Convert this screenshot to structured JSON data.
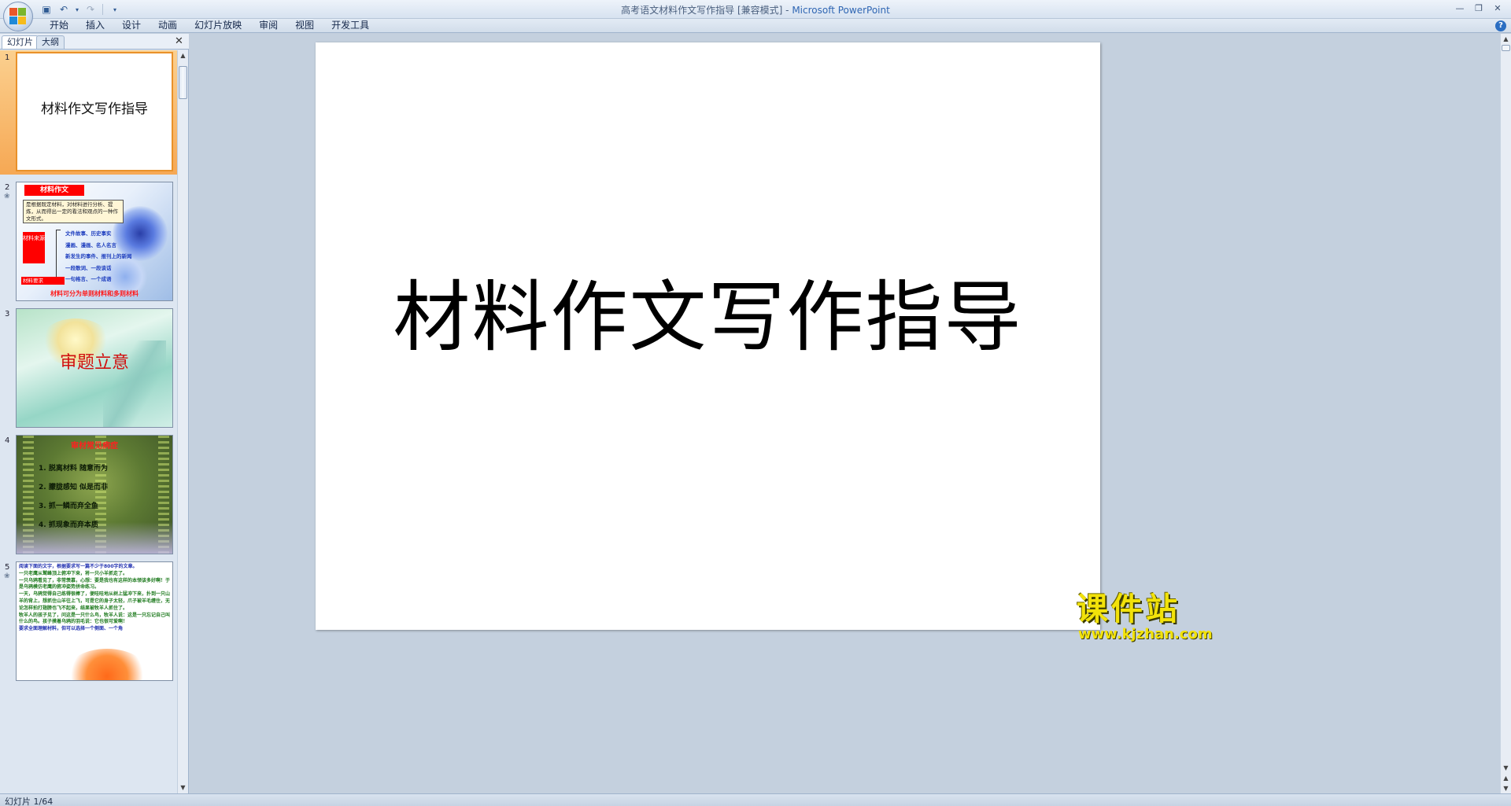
{
  "window": {
    "title_doc": "高考语文材料作文写作指导 [兼容模式] - ",
    "title_app": "Microsoft PowerPoint"
  },
  "qat": {
    "save_icon": "save-icon",
    "undo_icon": "undo-icon",
    "redo_icon": "redo-icon",
    "customize_icon": "chevron-down-icon"
  },
  "ribbon": {
    "tabs": [
      "开始",
      "插入",
      "设计",
      "动画",
      "幻灯片放映",
      "审阅",
      "视图",
      "开发工具"
    ]
  },
  "panel": {
    "tab_slides": "幻灯片",
    "tab_outline": "大纲"
  },
  "thumbnails": [
    {
      "number": "1",
      "title": "材料作文写作指导"
    },
    {
      "number": "2",
      "header": "材料作文",
      "box": "是根据既定材料，对材料进行分析、提炼，从而得出一定的看法和观点的一种作文形式。",
      "label1": "材料来源",
      "items": [
        "文件故事、历史事实",
        "漫画、漫画、名人名言",
        "新发生的事件、报刊上的新闻",
        "一段歌词、一段谈话",
        "一句格言、一个成语"
      ],
      "label2": "材料要求",
      "footer": "材料可分为单则材料和多则材料"
    },
    {
      "number": "3",
      "title": "审题立意"
    },
    {
      "number": "4",
      "title": "审材常见病症",
      "items": [
        "1. 脱离材料 随意而为",
        "2. 朦胧感知 似是而非",
        "3. 抓一鳞而弃全鱼",
        "4. 抓现象而弃本质"
      ]
    },
    {
      "number": "5",
      "lines": [
        "阅读下面的文字，根据要求写一篇不少于800字的文章。",
        "一只老鹰从鹫峰顶上俯冲下来，将一只小羊抓走了。",
        "一只乌鸦看见了，非常羡慕，心想：要是我也有这样的本领该多好啊！于是乌鸦模仿老鹰的俯冲姿势拼命练习。",
        "一天，乌鸦觉得自己练得很棒了，便哇哇地从树上猛冲下来，扑到一只山羊的背上，想抓住山羊往上飞，可是它的身子太轻，爪子被羊毛缠住，无论怎样拍打翅膀也飞不起来，结果被牧羊人抓住了。",
        "牧羊人的孩子见了，问这是一只什么鸟，牧羊人说：这是一只忘记自己叫什么的鸟。孩子摸着乌鸦的羽毛说：它也很可爱啊！",
        "要求全面理解材料，但可以选择一个侧面、一个角"
      ]
    }
  ],
  "slide": {
    "title": "材料作文写作指导"
  },
  "watermark": {
    "cn": "课件站",
    "url": "www.kjzhan.com"
  },
  "status": {
    "text": "幻灯片 1/64"
  },
  "colors": {
    "accent": "#2f66b3",
    "selection": "#f6a854",
    "slide_red": "#d11010"
  }
}
